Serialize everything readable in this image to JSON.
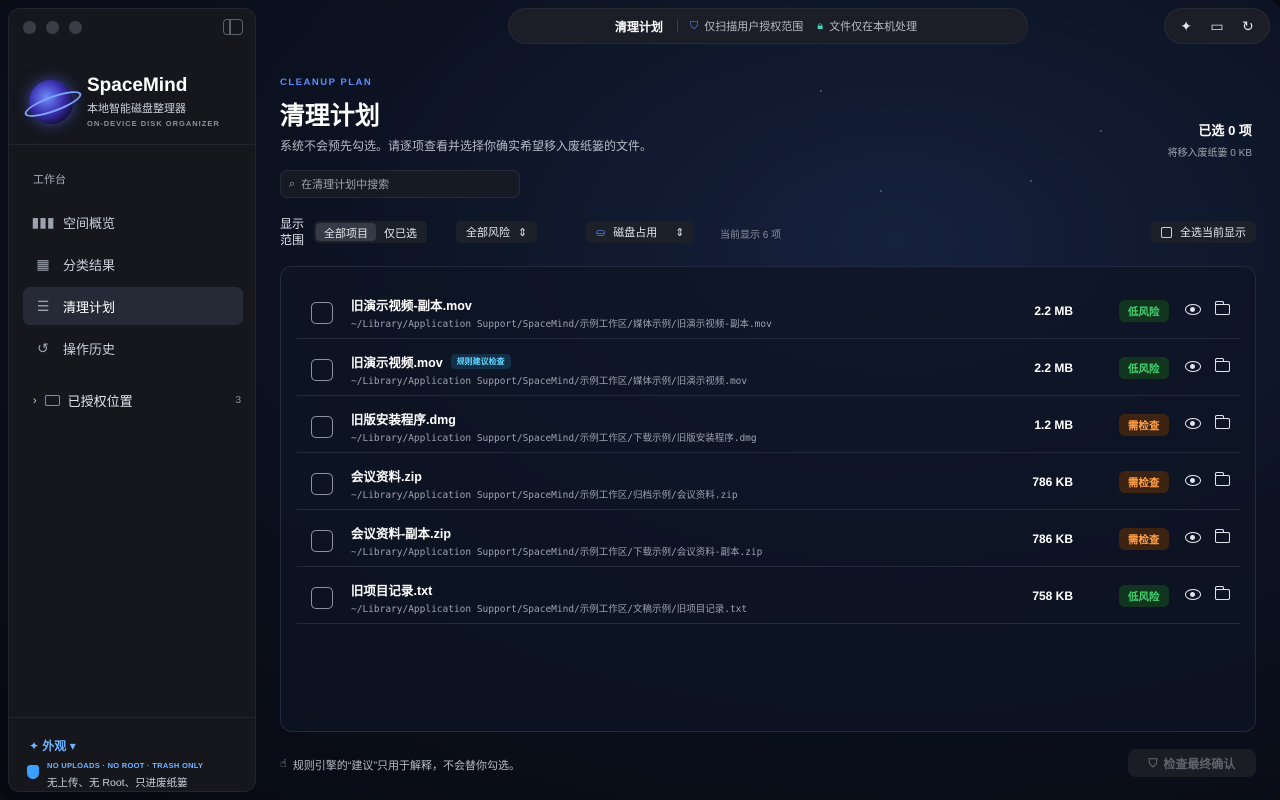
{
  "app": {
    "name": "SpaceMind",
    "subtitle": "本地智能磁盘整理器",
    "subtitle_en": "ON-DEVICE DISK ORGANIZER"
  },
  "sidebar": {
    "section_label": "工作台",
    "items": [
      {
        "label": "空间概览",
        "icon": "bar-chart-icon"
      },
      {
        "label": "分类结果",
        "icon": "grid-icon"
      },
      {
        "label": "清理计划",
        "icon": "checklist-icon",
        "active": true
      },
      {
        "label": "操作历史",
        "icon": "history-icon"
      }
    ],
    "authorized": {
      "label": "已授权位置",
      "count": "3"
    },
    "appearance": "外观",
    "privacy_en": "NO UPLOADS · NO ROOT · TRASH ONLY",
    "privacy_zh": "无上传、无 Root、只进废纸篓"
  },
  "topbar": {
    "title": "清理计划",
    "badge1": "仅扫描用户授权范围",
    "badge2": "文件仅在本机处理"
  },
  "main": {
    "eyebrow": "CLEANUP PLAN",
    "title": "清理计划",
    "description": "系统不会预先勾选。请逐项查看并选择你确实希望移入废纸篓的文件。",
    "selected_count": "已选 0 项",
    "selected_size": "将移入废纸篓 0 KB",
    "search_placeholder": "在清理计划中搜索",
    "filter_label": "显示范围",
    "seg_all": "全部项目",
    "seg_selected": "仅已选",
    "risk_filter": "全部风险",
    "sort_filter": "磁盘占用",
    "showing": "当前显示 6 项",
    "select_all": "全选当前显示"
  },
  "files": [
    {
      "name": "旧演示视频-副本.mov",
      "path": "~/Library/Application Support/SpaceMind/示例工作区/媒体示例/旧演示视频-副本.mov",
      "size": "2.2 MB",
      "risk": "低风险",
      "level": "low",
      "tag": ""
    },
    {
      "name": "旧演示视频.mov",
      "path": "~/Library/Application Support/SpaceMind/示例工作区/媒体示例/旧演示视频.mov",
      "size": "2.2 MB",
      "risk": "低风险",
      "level": "low",
      "tag": "规则建议检查"
    },
    {
      "name": "旧版安装程序.dmg",
      "path": "~/Library/Application Support/SpaceMind/示例工作区/下载示例/旧版安装程序.dmg",
      "size": "1.2 MB",
      "risk": "需检查",
      "level": "check",
      "tag": ""
    },
    {
      "name": "会议资料.zip",
      "path": "~/Library/Application Support/SpaceMind/示例工作区/归档示例/会议资料.zip",
      "size": "786 KB",
      "risk": "需检查",
      "level": "check",
      "tag": ""
    },
    {
      "name": "会议资料-副本.zip",
      "path": "~/Library/Application Support/SpaceMind/示例工作区/下载示例/会议资料-副本.zip",
      "size": "786 KB",
      "risk": "需检查",
      "level": "check",
      "tag": ""
    },
    {
      "name": "旧项目记录.txt",
      "path": "~/Library/Application Support/SpaceMind/示例工作区/文稿示例/旧项目记录.txt",
      "size": "758 KB",
      "risk": "低风险",
      "level": "low",
      "tag": ""
    }
  ],
  "footer": {
    "note": "规则引擎的“建议”只用于解释，不会替你勾选。",
    "confirm": "检查最终确认"
  },
  "colors": {
    "accent": "#5b8cff",
    "low_risk": "#42d26f",
    "check_risk": "#ff9d45"
  }
}
